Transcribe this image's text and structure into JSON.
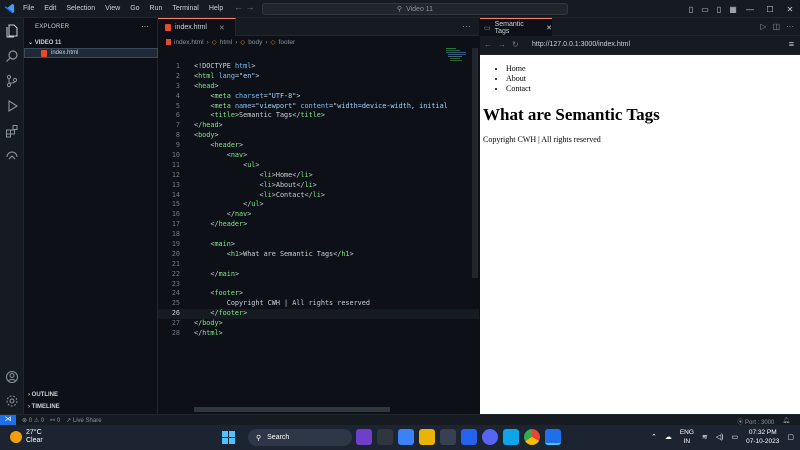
{
  "titlebar": {
    "menu": [
      "File",
      "Edit",
      "Selection",
      "View",
      "Go",
      "Run",
      "Terminal",
      "Help"
    ],
    "search": "Video 11"
  },
  "explorer": {
    "header": "EXPLORER",
    "folder": "VIDEO 11",
    "file": "index.html",
    "outline": "OUTLINE",
    "timeline": "TIMELINE"
  },
  "editor": {
    "tab": "index.html",
    "breadcrumb": [
      "index.html",
      "html",
      "body",
      "footer"
    ],
    "current_line": 26,
    "line_numbers": [
      "1",
      "2",
      "3",
      "4",
      "5",
      "6",
      "7",
      "8",
      "9",
      "10",
      "11",
      "12",
      "13",
      "14",
      "15",
      "16",
      "17",
      "18",
      "19",
      "20",
      "21",
      "22",
      "23",
      "24",
      "25",
      "26",
      "27",
      "28"
    ]
  },
  "preview": {
    "tab": "Semantic Tags",
    "url": "http://127.0.0.1:3000/index.html",
    "nav": [
      "Home",
      "About",
      "Contact"
    ],
    "heading": "What are Semantic Tags",
    "footer": "Copyright CWH | All rights reserved"
  },
  "statusbar": {
    "errors": "0",
    "warnings": "0",
    "ports": "0",
    "live_share": "Live Share",
    "port": "Port : 3000"
  },
  "taskbar": {
    "temp": "27°C",
    "weather": "Clear",
    "search": "Search",
    "lang1": "ENG",
    "lang2": "IN",
    "time": "07:32 PM",
    "date": "07-10-2023"
  },
  "colors": {
    "accent": "#f78166",
    "editor_bg": "#0d1117",
    "tag": "#7ee787",
    "attr": "#79c0ff"
  }
}
